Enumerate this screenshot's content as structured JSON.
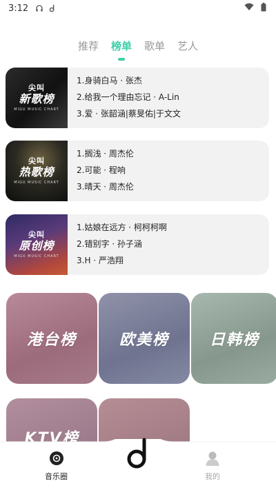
{
  "status_bar": {
    "time": "3:12"
  },
  "tabs": [
    {
      "label": "推荐"
    },
    {
      "label": "榜单"
    },
    {
      "label": "歌单"
    },
    {
      "label": "艺人"
    }
  ],
  "charts": [
    {
      "cover_top": "尖叫",
      "cover_main": "新歌榜",
      "cover_sub": "MIGU MUSIC CHART",
      "songs": [
        "1.身骑白马 · 张杰",
        "2.给我一个理由忘记 · A-Lin",
        "3.爱 · 张韶涵|蔡旻佑|于文文"
      ]
    },
    {
      "cover_top": "尖叫",
      "cover_main": "热歌榜",
      "cover_sub": "MIGU MUSIC CHART",
      "songs": [
        "1.搁浅 · 周杰伦",
        "2.可能 · 程响",
        "3.晴天 · 周杰伦"
      ]
    },
    {
      "cover_top": "尖叫",
      "cover_main": "原创榜",
      "cover_sub": "MIGU MUSIC CHART",
      "songs": [
        "1.姑娘在远方 · 柯柯柯啊",
        "2.错别字 · 孙子涵",
        "3.H · 严浩翔"
      ]
    }
  ],
  "region_tiles": [
    {
      "label": "港台榜"
    },
    {
      "label": "欧美榜"
    },
    {
      "label": "日韩榜"
    },
    {
      "label": "KTV榜"
    },
    {
      "label": ""
    }
  ],
  "bottom_nav": {
    "music_circle": "音乐圈",
    "mine": "我的"
  },
  "colors": {
    "accent": "#3dcfa8",
    "inactive_tab": "#999999",
    "card_bg": "#f2f2f3"
  }
}
